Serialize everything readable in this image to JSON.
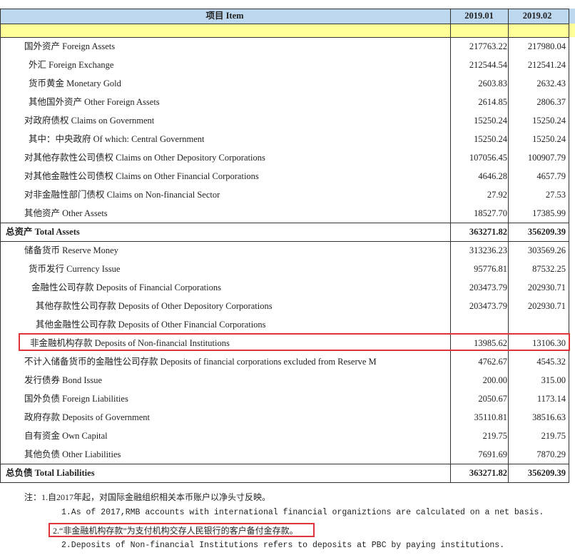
{
  "header": {
    "item_label": "项目 Item",
    "col1": "2019.01",
    "col2": "2019.02"
  },
  "rows": [
    {
      "label": "国外资产  Foreign Assets",
      "v1": "217763.22",
      "v2": "217980.04",
      "indent": 34,
      "bold": false
    },
    {
      "label": "外汇  Foreign Exchange",
      "v1": "212544.54",
      "v2": "212541.24",
      "indent": 40,
      "bold": false
    },
    {
      "label": "货币黄金  Monetary Gold",
      "v1": "2603.83",
      "v2": "2632.43",
      "indent": 40,
      "bold": false
    },
    {
      "label": "其他国外资产  Other Foreign Assets",
      "v1": "2614.85",
      "v2": "2806.37",
      "indent": 40,
      "bold": false
    },
    {
      "label": "对政府债权  Claims on Government",
      "v1": "15250.24",
      "v2": "15250.24",
      "indent": 34,
      "bold": false
    },
    {
      "label": "其中：中央政府  Of which: Central Government",
      "v1": "15250.24",
      "v2": "15250.24",
      "indent": 40,
      "bold": false
    },
    {
      "label": "对其他存款性公司债权  Claims on Other Depository Corporations",
      "v1": "107056.45",
      "v2": "100907.79",
      "indent": 34,
      "bold": false
    },
    {
      "label": "对其他金融性公司债权  Claims on Other Financial Corporations",
      "v1": "4646.28",
      "v2": "4657.79",
      "indent": 34,
      "bold": false
    },
    {
      "label": "对非金融性部门债权  Claims on Non-financial Sector",
      "v1": "27.92",
      "v2": "27.53",
      "indent": 34,
      "bold": false
    },
    {
      "label": "其他资产  Other Assets",
      "v1": "18527.70",
      "v2": "17385.99",
      "indent": 34,
      "bold": false
    },
    {
      "label": "总资产  Total Assets",
      "v1": "363271.82",
      "v2": "356209.39",
      "indent": 8,
      "bold": true
    },
    {
      "label": "储备货币  Reserve Money",
      "v1": "313236.23",
      "v2": "303569.26",
      "indent": 34,
      "bold": false
    },
    {
      "label": "货币发行  Currency Issue",
      "v1": "95776.81",
      "v2": "87532.25",
      "indent": 40,
      "bold": false
    },
    {
      "label": "金融性公司存款  Deposits of Financial Corporations",
      "v1": "203473.79",
      "v2": "202930.71",
      "indent": 44,
      "bold": false
    },
    {
      "label": "其他存款性公司存款  Deposits of Other Depository Corporations",
      "v1": "203473.79",
      "v2": "202930.71",
      "indent": 50,
      "bold": false
    },
    {
      "label": "其他金融性公司存款  Deposits of Other Financial Corporations",
      "v1": "",
      "v2": "",
      "indent": 50,
      "bold": false
    },
    {
      "label": "非金融机构存款  Deposits of Non-financial Institutions",
      "v1": "13985.62",
      "v2": "13106.30",
      "indent": 42,
      "bold": false
    },
    {
      "label": "不计入储备货币的金融性公司存款  Deposits of financial corporations excluded from Reserve M",
      "v1": "4762.67",
      "v2": "4545.32",
      "indent": 34,
      "bold": false
    },
    {
      "label": "发行债券  Bond Issue",
      "v1": "200.00",
      "v2": "315.00",
      "indent": 34,
      "bold": false
    },
    {
      "label": "国外负债  Foreign Liabilities",
      "v1": "2050.67",
      "v2": "1173.14",
      "indent": 34,
      "bold": false
    },
    {
      "label": "政府存款  Deposits of Government",
      "v1": "35110.81",
      "v2": "38516.63",
      "indent": 34,
      "bold": false
    },
    {
      "label": "自有资金  Own Capital",
      "v1": "219.75",
      "v2": "219.75",
      "indent": 34,
      "bold": false
    },
    {
      "label": "其他负债  Other Liabilities",
      "v1": "7691.69",
      "v2": "7870.29",
      "indent": 34,
      "bold": false
    },
    {
      "label": "总负债  Total  Liabilities",
      "v1": "363271.82",
      "v2": "356209.39",
      "indent": 8,
      "bold": true
    }
  ],
  "notes": {
    "note1_cn": "注：1.自2017年起，对国际金融组织相关本币账户以净头寸反映。",
    "note1_en": "1.As of 2017,RMB accounts with international financial organiztions are calculated on a net basis.",
    "note2_cn": "2.“非金融机构存款”为支付机构交存人民银行的客户备付金存款。",
    "note2_en": "2.Deposits of Non-financial Institutions refers to deposits at PBC by paying institutions."
  },
  "colors": {
    "header_bg": "#bdd7ee",
    "subheader_bg": "#ffff99",
    "highlight": "#e0343a"
  }
}
